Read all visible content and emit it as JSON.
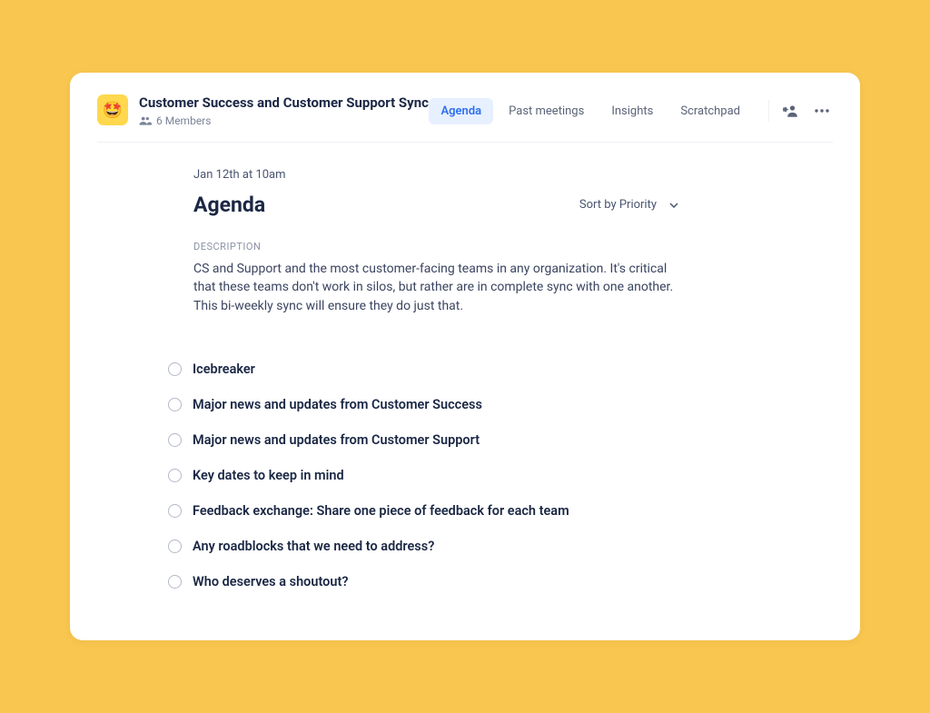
{
  "header": {
    "meeting_icon_emoji": "🤩",
    "title": "Customer Success and Customer Support Sync",
    "members_label": "6 Members"
  },
  "tabs": [
    {
      "label": "Agenda",
      "active": true
    },
    {
      "label": "Past meetings",
      "active": false
    },
    {
      "label": "Insights",
      "active": false
    },
    {
      "label": "Scratchpad",
      "active": false
    }
  ],
  "content": {
    "date_text": "Jan 12th at 10am",
    "agenda_heading": "Agenda",
    "sort_label": "Sort by Priority",
    "description_label": "DESCRIPTION",
    "description_text": "CS and Support and the most customer-facing teams in any organization. It's critical that these teams don't work in silos, but rather are in complete sync with one another. This bi-weekly sync will ensure they do just that."
  },
  "agenda_items": [
    "Icebreaker",
    "Major news and updates from Customer Success",
    "Major news and updates from Customer Support",
    "Key dates to keep in mind",
    "Feedback exchange: Share one piece of feedback for each team",
    "Any roadblocks that we need to address?",
    "Who deserves a shoutout?"
  ]
}
